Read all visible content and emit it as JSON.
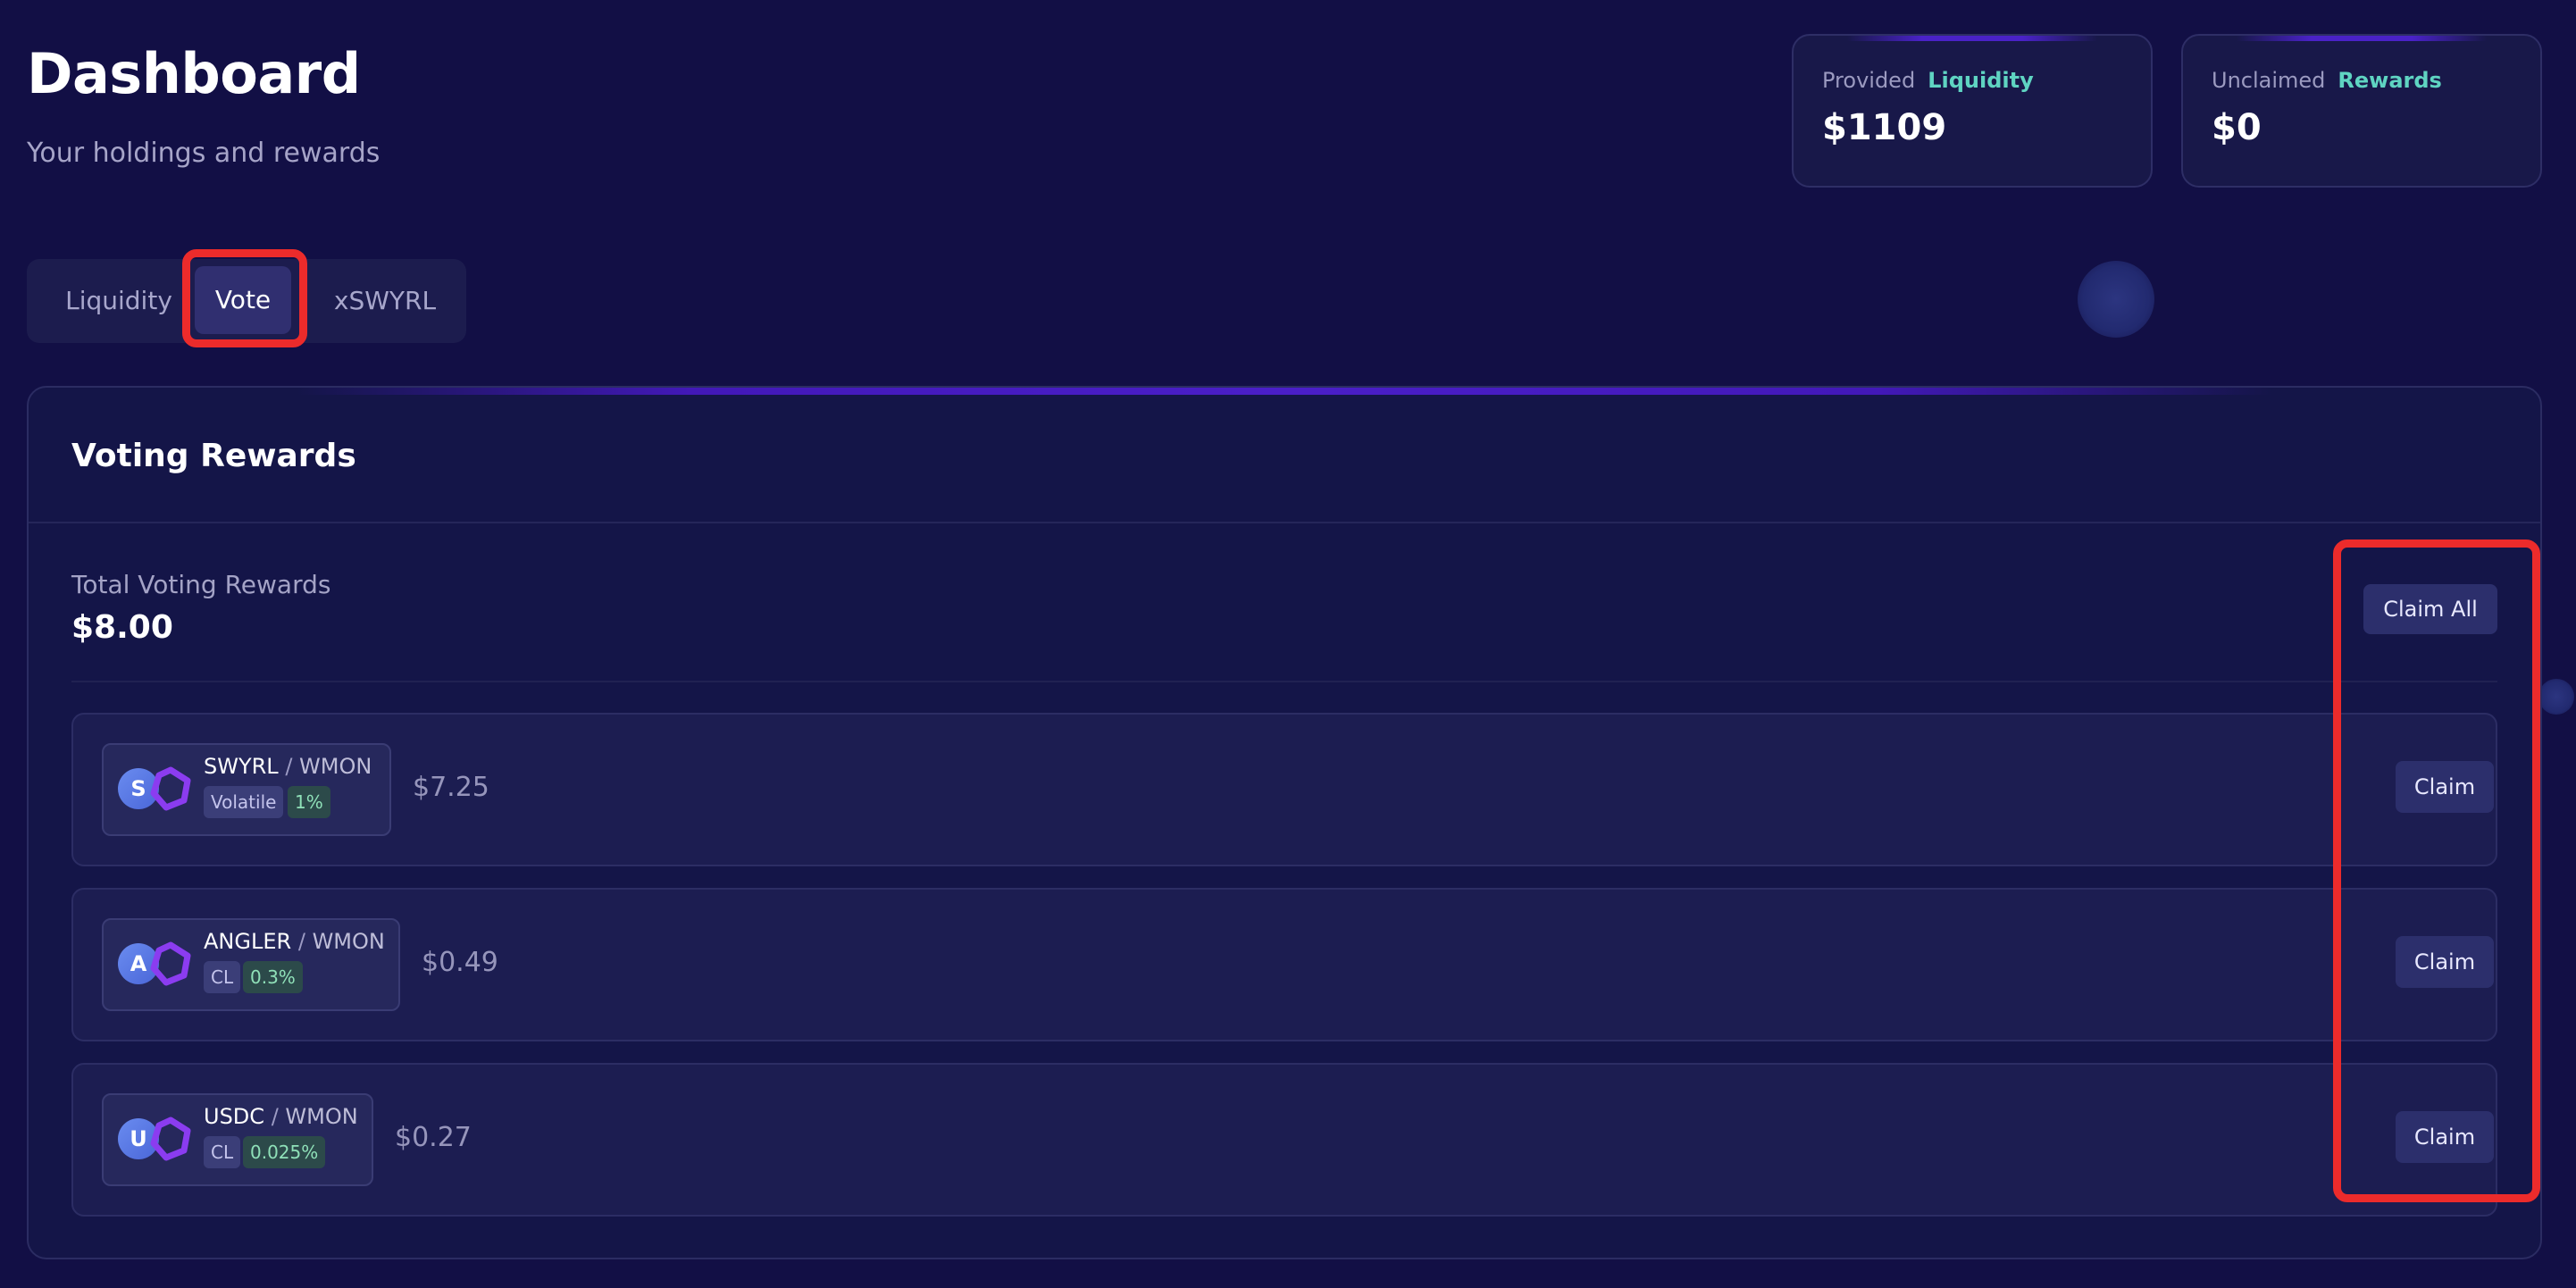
{
  "header": {
    "title": "Dashboard",
    "subtitle": "Your holdings and rewards"
  },
  "stats": [
    {
      "label": "Provided",
      "accent": "Liquidity",
      "value": "$1109"
    },
    {
      "label": "Unclaimed",
      "accent": "Rewards",
      "value": "$0"
    }
  ],
  "tabs": [
    {
      "label": "Liquidity"
    },
    {
      "label": "Vote",
      "active": true
    },
    {
      "label": "xSWYRL"
    }
  ],
  "panel": {
    "title": "Voting Rewards",
    "total_label": "Total Voting Rewards",
    "total_value": "$8.00",
    "claim_all_label": "Claim All"
  },
  "rows": [
    {
      "token": "SWYRL",
      "token_initial": "S",
      "separator": "/",
      "quote": "WMON",
      "type": "Volatile",
      "fee": "1%",
      "amount": "$7.25",
      "claim_label": "Claim"
    },
    {
      "token": "ANGLER",
      "token_initial": "A",
      "separator": "/",
      "quote": "WMON",
      "type": "CL",
      "fee": "0.3%",
      "amount": "$0.49",
      "claim_label": "Claim"
    },
    {
      "token": "USDC",
      "token_initial": "U",
      "separator": "/",
      "quote": "WMON",
      "type": "CL",
      "fee": "0.025%",
      "amount": "$0.27",
      "claim_label": "Claim"
    }
  ],
  "colors": {
    "background": "#120f45",
    "accent_teal": "#5fd4c2",
    "highlight_red": "#ec2b2b",
    "button": "#2c2f6c",
    "quote_token_purple": "#8b3cf0"
  },
  "icons": {
    "quote_token": "wmon-token-icon"
  }
}
